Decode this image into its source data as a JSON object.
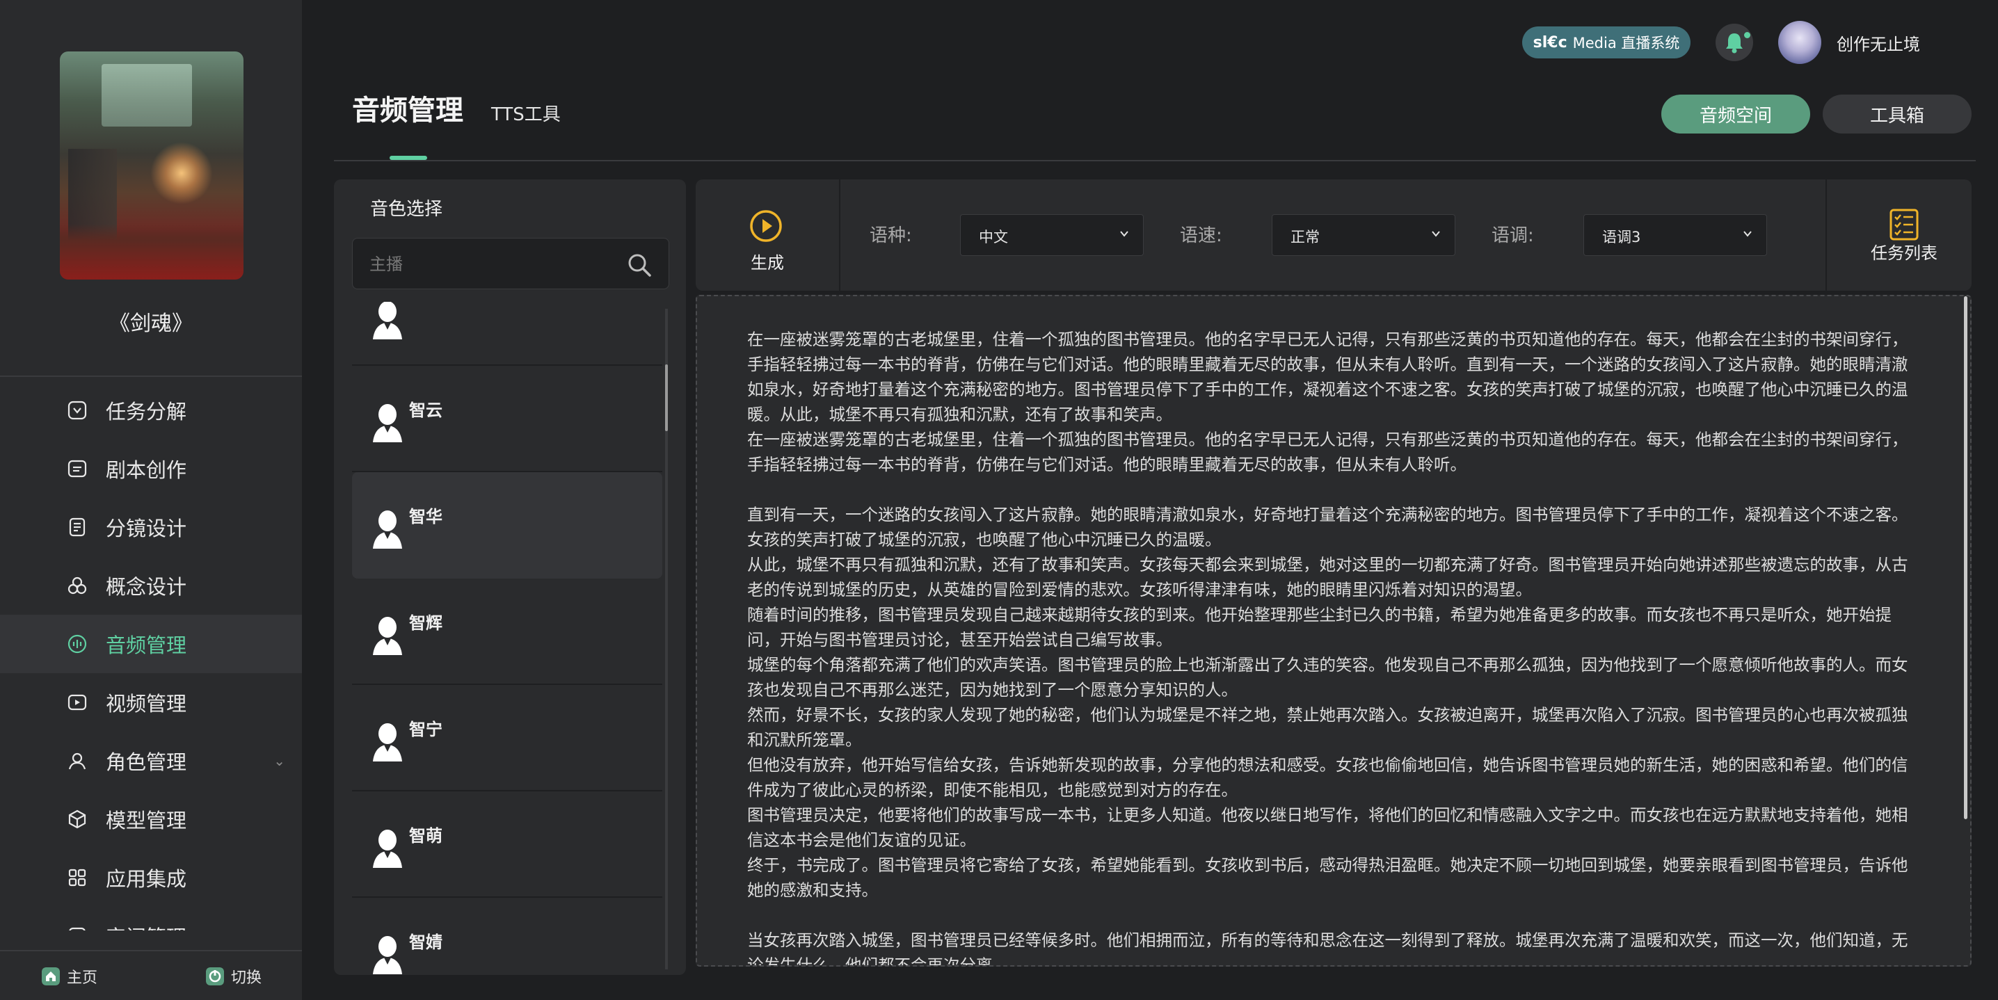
{
  "header": {
    "live_badge_logo": "sl€c",
    "live_badge_label": "Media 直播系统",
    "username": "创作无止境"
  },
  "sidebar": {
    "book_title": "《剑魂》",
    "nav": [
      {
        "label": "任务分解",
        "icon": "task-icon",
        "active": false
      },
      {
        "label": "剧本创作",
        "icon": "script-icon",
        "active": false
      },
      {
        "label": "分镜设计",
        "icon": "storyboard-icon",
        "active": false
      },
      {
        "label": "概念设计",
        "icon": "concept-icon",
        "active": false
      },
      {
        "label": "音频管理",
        "icon": "audio-icon",
        "active": true
      },
      {
        "label": "视频管理",
        "icon": "video-icon",
        "active": false
      },
      {
        "label": "角色管理",
        "icon": "role-icon",
        "active": false
      },
      {
        "label": "模型管理",
        "icon": "model-icon",
        "active": false
      },
      {
        "label": "应用集成",
        "icon": "apps-icon",
        "active": false
      },
      {
        "label": "审阅管理",
        "icon": "review-icon",
        "active": false
      }
    ],
    "bottom_home": "主页",
    "bottom_switch": "切换"
  },
  "page": {
    "title": "音频管理",
    "subtitle": "TTS工具",
    "btn_space": "音频空间",
    "btn_tools": "工具箱"
  },
  "voice_panel": {
    "title": "音色选择",
    "search_placeholder": "主播",
    "voices": [
      "智云",
      "智华",
      "智辉",
      "智宁",
      "智萌",
      "智婧"
    ],
    "selected": "智华"
  },
  "toolbar": {
    "generate": "生成",
    "lang_label": "语种:",
    "lang_value": "中文",
    "speed_label": "语速:",
    "speed_value": "正常",
    "tone_label": "语调:",
    "tone_value": "语调3",
    "task_list": "任务列表"
  },
  "editor": {
    "text": "在一座被迷雾笼罩的古老城堡里，住着一个孤独的图书管理员。他的名字早已无人记得，只有那些泛黄的书页知道他的存在。每天，他都会在尘封的书架间穿行，手指轻轻拂过每一本书的脊背，仿佛在与它们对话。他的眼睛里藏着无尽的故事，但从未有人聆听。直到有一天，一个迷路的女孩闯入了这片寂静。她的眼睛清澈如泉水，好奇地打量着这个充满秘密的地方。图书管理员停下了手中的工作，凝视着这个不速之客。女孩的笑声打破了城堡的沉寂，也唤醒了他心中沉睡已久的温暖。从此，城堡不再只有孤独和沉默，还有了故事和笑声。\n在一座被迷雾笼罩的古老城堡里，住着一个孤独的图书管理员。他的名字早已无人记得，只有那些泛黄的书页知道他的存在。每天，他都会在尘封的书架间穿行，手指轻轻拂过每一本书的脊背，仿佛在与它们对话。他的眼睛里藏着无尽的故事，但从未有人聆听。\n\n直到有一天，一个迷路的女孩闯入了这片寂静。她的眼睛清澈如泉水，好奇地打量着这个充满秘密的地方。图书管理员停下了手中的工作，凝视着这个不速之客。女孩的笑声打破了城堡的沉寂，也唤醒了他心中沉睡已久的温暖。\n从此，城堡不再只有孤独和沉默，还有了故事和笑声。女孩每天都会来到城堡，她对这里的一切都充满了好奇。图书管理员开始向她讲述那些被遗忘的故事，从古老的传说到城堡的历史，从英雄的冒险到爱情的悲欢。女孩听得津津有味，她的眼睛里闪烁着对知识的渴望。\n随着时间的推移，图书管理员发现自己越来越期待女孩的到来。他开始整理那些尘封已久的书籍，希望为她准备更多的故事。而女孩也不再只是听众，她开始提问，开始与图书管理员讨论，甚至开始尝试自己编写故事。\n城堡的每个角落都充满了他们的欢声笑语。图书管理员的脸上也渐渐露出了久违的笑容。他发现自己不再那么孤独，因为他找到了一个愿意倾听他故事的人。而女孩也发现自己不再那么迷茫，因为她找到了一个愿意分享知识的人。\n然而，好景不长，女孩的家人发现了她的秘密，他们认为城堡是不祥之地，禁止她再次踏入。女孩被迫离开，城堡再次陷入了沉寂。图书管理员的心也再次被孤独和沉默所笼罩。\n但他没有放弃，他开始写信给女孩，告诉她新发现的故事，分享他的想法和感受。女孩也偷偷地回信，她告诉图书管理员她的新生活，她的困惑和希望。他们的信件成为了彼此心灵的桥梁，即使不能相见，也能感觉到对方的存在。\n图书管理员决定，他要将他们的故事写成一本书，让更多人知道。他夜以继日地写作，将他们的回忆和情感融入文字之中。而女孩也在远方默默地支持着他，她相信这本书会是他们友谊的见证。\n终于，书完成了。图书管理员将它寄给了女孩，希望她能看到。女孩收到书后，感动得热泪盈眶。她决定不顾一切地回到城堡，她要亲眼看到图书管理员，告诉他她的感激和支持。\n\n当女孩再次踏入城堡，图书管理员已经等候多时。他们相拥而泣，所有的等待和思念在这一刻得到了释放。城堡再次充满了温暖和欢笑，而这一次，他们知道，无论发生什么，他们都不会再次分离。"
  },
  "colors": {
    "accent": "#5fd0a2",
    "accent_button": "#5a9c7e",
    "live_badge": "#3f6f78",
    "background": "#1e1f21",
    "panel": "#2a2b2d"
  }
}
